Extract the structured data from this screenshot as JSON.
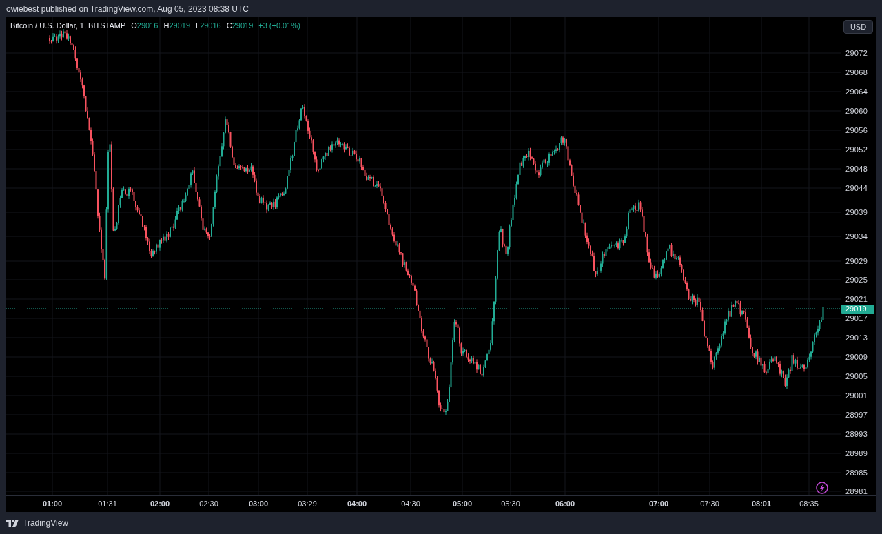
{
  "header": {
    "text": "owiebest published on TradingView.com, Aug 05, 2023 08:38 UTC"
  },
  "legend": {
    "symbol": "Bitcoin / U.S. Dollar, 1, BITSTAMP",
    "ohlc": [
      {
        "label": "O",
        "value": "29016"
      },
      {
        "label": "H",
        "value": "29019"
      },
      {
        "label": "L",
        "value": "29016"
      },
      {
        "label": "C",
        "value": "29019"
      }
    ],
    "change": "+3 (+0.01%)"
  },
  "currency_button": "USD",
  "price_axis": {
    "labels": [
      "29072",
      "29068",
      "29064",
      "29060",
      "29056",
      "29052",
      "29048",
      "29044",
      "29039",
      "29034",
      "29029",
      "29025",
      "29021",
      "29017",
      "29013",
      "29009",
      "29005",
      "29001",
      "28997",
      "28993",
      "28989",
      "28985",
      "28981"
    ],
    "last_price": "29019"
  },
  "time_axis": {
    "labels": [
      {
        "text": "01:00",
        "major": true
      },
      {
        "text": "01:31",
        "major": false
      },
      {
        "text": "02:00",
        "major": true
      },
      {
        "text": "02:30",
        "major": false
      },
      {
        "text": "03:00",
        "major": true
      },
      {
        "text": "03:29",
        "major": false
      },
      {
        "text": "04:00",
        "major": true
      },
      {
        "text": "04:30",
        "major": false
      },
      {
        "text": "05:00",
        "major": true
      },
      {
        "text": "05:30",
        "major": false
      },
      {
        "text": "06:00",
        "major": true
      },
      {
        "text": "07:00",
        "major": true
      },
      {
        "text": "07:30",
        "major": false
      },
      {
        "text": "08:01",
        "major": true
      },
      {
        "text": "08:35",
        "major": false
      }
    ]
  },
  "footer": {
    "brand": "TradingView"
  }
}
